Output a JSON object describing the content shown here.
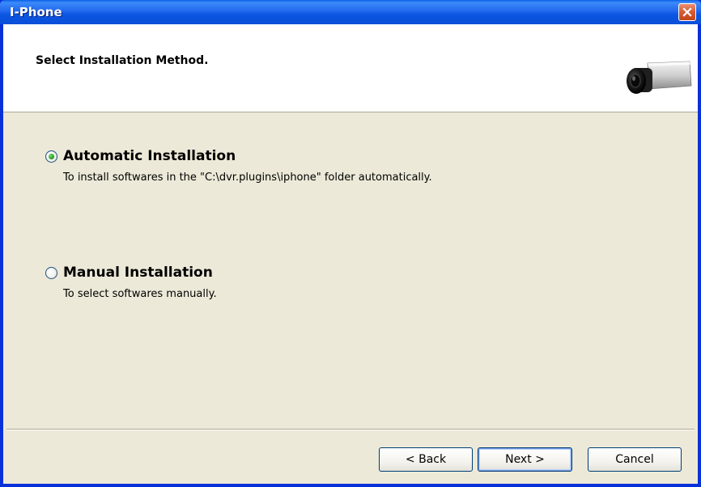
{
  "window": {
    "title": "I-Phone"
  },
  "header": {
    "title": "Select Installation Method."
  },
  "options": [
    {
      "label": "Automatic Installation",
      "description": "To install softwares in the \"C:\\dvr.plugins\\iphone\" folder automatically.",
      "selected": true
    },
    {
      "label": "Manual Installation",
      "description": "To select softwares manually.",
      "selected": false
    }
  ],
  "buttons": {
    "back": "< Back",
    "next": "Next >",
    "cancel": "Cancel"
  },
  "colors": {
    "titlebar": "#0A4ED8",
    "close": "#D75A31",
    "face": "#ECE9D8",
    "radio_dot": "#21A121"
  },
  "icons": {
    "close": "close-icon",
    "header": "security-camera-icon"
  }
}
